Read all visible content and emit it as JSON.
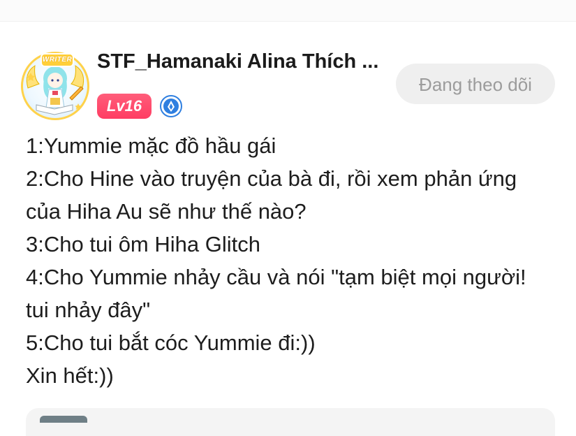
{
  "author": {
    "name": "STF_Hamanaki Alina Thích ...",
    "avatar_badge": "WRITER",
    "level": "Lv16",
    "verified_icon": "verified-badge-icon"
  },
  "follow_button": {
    "label": "Đang theo dõi"
  },
  "post": {
    "lines": [
      "1:Yummie mặc đồ hầu gái",
      "2:Cho Hine vào truyện của bà đi, rồi xem phản ứng",
      "của Hiha Au sẽ như thế nào?",
      "3:Cho tui ôm Hiha Glitch",
      "4:Cho Yummie nhảy cầu và nói \"tạm biệt mọi người!",
      "tui nhảy đây\"",
      "5:Cho tui bắt cóc Yummie đi:))",
      "Xin hết:))"
    ]
  },
  "colors": {
    "level_badge": "#ff4668",
    "follow_button_bg": "#efefef",
    "follow_button_text": "#9c9c9c",
    "verified": "#2f7fe0"
  }
}
